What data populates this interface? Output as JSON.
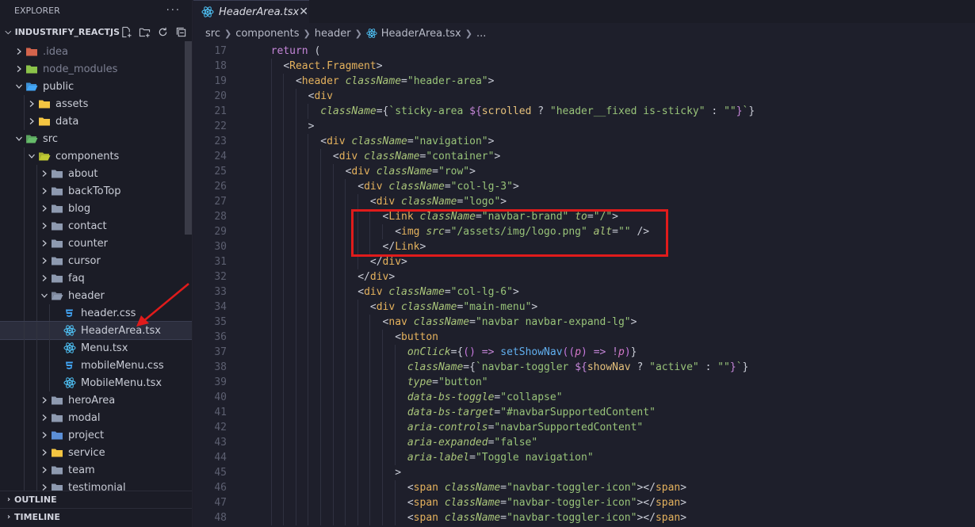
{
  "sidebar": {
    "title": "EXPLORER",
    "more": "···",
    "workspace": "INDUSTRIFY_REACTJS",
    "actions": [
      "new-file-icon",
      "new-folder-icon",
      "refresh-icon",
      "collapse-all-icon"
    ],
    "tree": [
      {
        "label": ".idea",
        "depth": 0,
        "type": "folder",
        "icon": "idea-folder-icon",
        "color": "#d4644c",
        "dim": true
      },
      {
        "label": "node_modules",
        "depth": 0,
        "type": "folder",
        "icon": "node-folder-icon",
        "color": "#8bc34a",
        "dim": true
      },
      {
        "label": "public",
        "depth": 0,
        "type": "folder-open",
        "icon": "public-folder-icon",
        "color": "#42a5f5"
      },
      {
        "label": "assets",
        "depth": 1,
        "type": "folder",
        "icon": "folder-icon",
        "color": "#f4c542"
      },
      {
        "label": "data",
        "depth": 1,
        "type": "folder",
        "icon": "folder-icon",
        "color": "#f4c542"
      },
      {
        "label": "src",
        "depth": 0,
        "type": "folder-open",
        "icon": "src-folder-icon",
        "color": "#66bb6a"
      },
      {
        "label": "components",
        "depth": 1,
        "type": "folder-open",
        "icon": "components-folder-icon",
        "color": "#c0ca33"
      },
      {
        "label": "about",
        "depth": 2,
        "type": "folder",
        "icon": "folder-icon",
        "color": "#8e9ab0"
      },
      {
        "label": "backToTop",
        "depth": 2,
        "type": "folder",
        "icon": "folder-icon",
        "color": "#8e9ab0"
      },
      {
        "label": "blog",
        "depth": 2,
        "type": "folder",
        "icon": "folder-icon",
        "color": "#8e9ab0"
      },
      {
        "label": "contact",
        "depth": 2,
        "type": "folder",
        "icon": "folder-icon",
        "color": "#8e9ab0"
      },
      {
        "label": "counter",
        "depth": 2,
        "type": "folder",
        "icon": "folder-icon",
        "color": "#8e9ab0"
      },
      {
        "label": "cursor",
        "depth": 2,
        "type": "folder",
        "icon": "folder-icon",
        "color": "#8e9ab0"
      },
      {
        "label": "faq",
        "depth": 2,
        "type": "folder",
        "icon": "folder-icon",
        "color": "#8e9ab0"
      },
      {
        "label": "header",
        "depth": 2,
        "type": "folder-open",
        "icon": "folder-icon",
        "color": "#8e9ab0"
      },
      {
        "label": "header.css",
        "depth": 3,
        "type": "css",
        "icon": "css-file-icon",
        "color": "#42a5f5"
      },
      {
        "label": "HeaderArea.tsx",
        "depth": 3,
        "type": "react",
        "icon": "react-file-icon",
        "color": "#4fc3f7",
        "selected": true
      },
      {
        "label": "Menu.tsx",
        "depth": 3,
        "type": "react",
        "icon": "react-file-icon",
        "color": "#4fc3f7"
      },
      {
        "label": "mobileMenu.css",
        "depth": 3,
        "type": "css",
        "icon": "css-file-icon",
        "color": "#42a5f5"
      },
      {
        "label": "MobileMenu.tsx",
        "depth": 3,
        "type": "react",
        "icon": "react-file-icon",
        "color": "#4fc3f7"
      },
      {
        "label": "heroArea",
        "depth": 2,
        "type": "folder",
        "icon": "folder-icon",
        "color": "#8e9ab0"
      },
      {
        "label": "modal",
        "depth": 2,
        "type": "folder",
        "icon": "folder-icon",
        "color": "#8e9ab0"
      },
      {
        "label": "project",
        "depth": 2,
        "type": "folder",
        "icon": "project-folder-icon",
        "color": "#5c8fd6"
      },
      {
        "label": "service",
        "depth": 2,
        "type": "folder",
        "icon": "service-folder-icon",
        "color": "#f4c542"
      },
      {
        "label": "team",
        "depth": 2,
        "type": "folder",
        "icon": "folder-icon",
        "color": "#8e9ab0"
      },
      {
        "label": "testimonial",
        "depth": 2,
        "type": "folder",
        "icon": "folder-icon",
        "color": "#8e9ab0"
      }
    ],
    "outline": "OUTLINE",
    "timeline": "TIMELINE"
  },
  "editor": {
    "tab": {
      "label": "HeaderArea.tsx",
      "close": "✕"
    },
    "breadcrumbs": [
      "src",
      "components",
      "header",
      "HeaderArea.tsx",
      "..."
    ],
    "lines": [
      {
        "n": "17",
        "indent": 0,
        "tokens": [
          [
            "kw",
            "return"
          ],
          [
            "punc",
            " ("
          ]
        ]
      },
      {
        "n": "18",
        "indent": 1,
        "tokens": [
          [
            "punc",
            "<"
          ],
          [
            "tag",
            "React.Fragment"
          ],
          [
            "punc",
            ">"
          ]
        ]
      },
      {
        "n": "19",
        "indent": 2,
        "tokens": [
          [
            "punc",
            "<"
          ],
          [
            "tag",
            "header"
          ],
          [
            "punc",
            " "
          ],
          [
            "attr",
            "className"
          ],
          [
            "punc",
            "="
          ],
          [
            "str",
            "\"header-area\""
          ],
          [
            "punc",
            ">"
          ]
        ]
      },
      {
        "n": "20",
        "indent": 3,
        "tokens": [
          [
            "punc",
            "<"
          ],
          [
            "tag",
            "div"
          ]
        ]
      },
      {
        "n": "21",
        "indent": 4,
        "tokens": [
          [
            "attr",
            "className"
          ],
          [
            "punc",
            "={"
          ],
          [
            "str",
            "`sticky-area "
          ],
          [
            "kw",
            "${"
          ],
          [
            "var",
            "scrolled"
          ],
          [
            "punc",
            " ? "
          ],
          [
            "str",
            "\"header__fixed is-sticky\""
          ],
          [
            "punc",
            " : "
          ],
          [
            "str",
            "\"\""
          ],
          [
            "kw",
            "}"
          ],
          [
            "str",
            "`"
          ],
          [
            "punc",
            "}"
          ]
        ]
      },
      {
        "n": "22",
        "indent": 3,
        "tokens": [
          [
            "punc",
            ">"
          ]
        ]
      },
      {
        "n": "23",
        "indent": 4,
        "tokens": [
          [
            "punc",
            "<"
          ],
          [
            "tag",
            "div"
          ],
          [
            "punc",
            " "
          ],
          [
            "attr",
            "className"
          ],
          [
            "punc",
            "="
          ],
          [
            "str",
            "\"navigation\""
          ],
          [
            "punc",
            ">"
          ]
        ]
      },
      {
        "n": "24",
        "indent": 5,
        "tokens": [
          [
            "punc",
            "<"
          ],
          [
            "tag",
            "div"
          ],
          [
            "punc",
            " "
          ],
          [
            "attr",
            "className"
          ],
          [
            "punc",
            "="
          ],
          [
            "str",
            "\"container\""
          ],
          [
            "punc",
            ">"
          ]
        ]
      },
      {
        "n": "25",
        "indent": 6,
        "tokens": [
          [
            "punc",
            "<"
          ],
          [
            "tag",
            "div"
          ],
          [
            "punc",
            " "
          ],
          [
            "attr",
            "className"
          ],
          [
            "punc",
            "="
          ],
          [
            "str",
            "\"row\""
          ],
          [
            "punc",
            ">"
          ]
        ]
      },
      {
        "n": "26",
        "indent": 7,
        "tokens": [
          [
            "punc",
            "<"
          ],
          [
            "tag",
            "div"
          ],
          [
            "punc",
            " "
          ],
          [
            "attr",
            "className"
          ],
          [
            "punc",
            "="
          ],
          [
            "str",
            "\"col-lg-3\""
          ],
          [
            "punc",
            ">"
          ]
        ]
      },
      {
        "n": "27",
        "indent": 8,
        "tokens": [
          [
            "punc",
            "<"
          ],
          [
            "tag",
            "div"
          ],
          [
            "punc",
            " "
          ],
          [
            "attr",
            "className"
          ],
          [
            "punc",
            "="
          ],
          [
            "str",
            "\"logo\""
          ],
          [
            "punc",
            ">"
          ]
        ]
      },
      {
        "n": "28",
        "indent": 9,
        "tokens": [
          [
            "punc",
            "<"
          ],
          [
            "tag",
            "Link"
          ],
          [
            "punc",
            " "
          ],
          [
            "attr",
            "className"
          ],
          [
            "punc",
            "="
          ],
          [
            "str",
            "\"navbar-brand\""
          ],
          [
            "punc",
            " "
          ],
          [
            "attr",
            "to"
          ],
          [
            "punc",
            "="
          ],
          [
            "str",
            "\"/\""
          ],
          [
            "punc",
            ">"
          ]
        ]
      },
      {
        "n": "29",
        "indent": 10,
        "tokens": [
          [
            "punc",
            "<"
          ],
          [
            "tag",
            "img"
          ],
          [
            "punc",
            " "
          ],
          [
            "attr",
            "src"
          ],
          [
            "punc",
            "="
          ],
          [
            "str",
            "\"/assets/img/logo.png\""
          ],
          [
            "punc",
            " "
          ],
          [
            "attr",
            "alt"
          ],
          [
            "punc",
            "="
          ],
          [
            "str",
            "\"\""
          ],
          [
            "punc",
            " />"
          ]
        ]
      },
      {
        "n": "30",
        "indent": 9,
        "tokens": [
          [
            "punc",
            "</"
          ],
          [
            "tag",
            "Link"
          ],
          [
            "punc",
            ">"
          ]
        ]
      },
      {
        "n": "31",
        "indent": 8,
        "tokens": [
          [
            "punc",
            "</"
          ],
          [
            "tag",
            "div"
          ],
          [
            "punc",
            ">"
          ]
        ]
      },
      {
        "n": "32",
        "indent": 7,
        "tokens": [
          [
            "punc",
            "</"
          ],
          [
            "tag",
            "div"
          ],
          [
            "punc",
            ">"
          ]
        ]
      },
      {
        "n": "33",
        "indent": 7,
        "tokens": [
          [
            "punc",
            "<"
          ],
          [
            "tag",
            "div"
          ],
          [
            "punc",
            " "
          ],
          [
            "attr",
            "className"
          ],
          [
            "punc",
            "="
          ],
          [
            "str",
            "\"col-lg-6\""
          ],
          [
            "punc",
            ">"
          ]
        ]
      },
      {
        "n": "34",
        "indent": 8,
        "tokens": [
          [
            "punc",
            "<"
          ],
          [
            "tag",
            "div"
          ],
          [
            "punc",
            " "
          ],
          [
            "attr",
            "className"
          ],
          [
            "punc",
            "="
          ],
          [
            "str",
            "\"main-menu\""
          ],
          [
            "punc",
            ">"
          ]
        ]
      },
      {
        "n": "35",
        "indent": 9,
        "tokens": [
          [
            "punc",
            "<"
          ],
          [
            "tag",
            "nav"
          ],
          [
            "punc",
            " "
          ],
          [
            "attr",
            "className"
          ],
          [
            "punc",
            "="
          ],
          [
            "str",
            "\"navbar navbar-expand-lg\""
          ],
          [
            "punc",
            ">"
          ]
        ]
      },
      {
        "n": "36",
        "indent": 10,
        "tokens": [
          [
            "punc",
            "<"
          ],
          [
            "tag",
            "button"
          ]
        ]
      },
      {
        "n": "37",
        "indent": 11,
        "tokens": [
          [
            "attr",
            "onClick"
          ],
          [
            "punc",
            "={"
          ],
          [
            "bracket",
            "("
          ],
          [
            "bracket",
            ")"
          ],
          [
            "punc",
            " "
          ],
          [
            "kw",
            "=>"
          ],
          [
            "punc",
            " "
          ],
          [
            "fn",
            "setShowNav"
          ],
          [
            "bracket",
            "(("
          ],
          [
            "param",
            "p"
          ],
          [
            "bracket",
            ")"
          ],
          [
            "punc",
            " "
          ],
          [
            "kw",
            "=>"
          ],
          [
            "punc",
            " "
          ],
          [
            "kw",
            "!"
          ],
          [
            "param",
            "p"
          ],
          [
            "bracket",
            ")"
          ],
          [
            "punc",
            "}"
          ]
        ]
      },
      {
        "n": "38",
        "indent": 11,
        "tokens": [
          [
            "attr",
            "className"
          ],
          [
            "punc",
            "={"
          ],
          [
            "str",
            "`navbar-toggler "
          ],
          [
            "kw",
            "${"
          ],
          [
            "var",
            "showNav"
          ],
          [
            "punc",
            " ? "
          ],
          [
            "str",
            "\"active\""
          ],
          [
            "punc",
            " : "
          ],
          [
            "str",
            "\"\""
          ],
          [
            "kw",
            "}"
          ],
          [
            "str",
            "`"
          ],
          [
            "punc",
            "}"
          ]
        ]
      },
      {
        "n": "39",
        "indent": 11,
        "tokens": [
          [
            "attr",
            "type"
          ],
          [
            "punc",
            "="
          ],
          [
            "str",
            "\"button\""
          ]
        ]
      },
      {
        "n": "40",
        "indent": 11,
        "tokens": [
          [
            "attr",
            "data-bs-toggle"
          ],
          [
            "punc",
            "="
          ],
          [
            "str",
            "\"collapse\""
          ]
        ]
      },
      {
        "n": "41",
        "indent": 11,
        "tokens": [
          [
            "attr",
            "data-bs-target"
          ],
          [
            "punc",
            "="
          ],
          [
            "str",
            "\"#navbarSupportedContent\""
          ]
        ]
      },
      {
        "n": "42",
        "indent": 11,
        "tokens": [
          [
            "attr",
            "aria-controls"
          ],
          [
            "punc",
            "="
          ],
          [
            "str",
            "\"navbarSupportedContent\""
          ]
        ]
      },
      {
        "n": "43",
        "indent": 11,
        "tokens": [
          [
            "attr",
            "aria-expanded"
          ],
          [
            "punc",
            "="
          ],
          [
            "str",
            "\"false\""
          ]
        ]
      },
      {
        "n": "44",
        "indent": 11,
        "tokens": [
          [
            "attr",
            "aria-label"
          ],
          [
            "punc",
            "="
          ],
          [
            "str",
            "\"Toggle navigation\""
          ]
        ]
      },
      {
        "n": "45",
        "indent": 10,
        "tokens": [
          [
            "punc",
            ">"
          ]
        ]
      },
      {
        "n": "46",
        "indent": 11,
        "tokens": [
          [
            "punc",
            "<"
          ],
          [
            "tag",
            "span"
          ],
          [
            "punc",
            " "
          ],
          [
            "attr",
            "className"
          ],
          [
            "punc",
            "="
          ],
          [
            "str",
            "\"navbar-toggler-icon\""
          ],
          [
            "punc",
            "></"
          ],
          [
            "tag",
            "span"
          ],
          [
            "punc",
            ">"
          ]
        ]
      },
      {
        "n": "47",
        "indent": 11,
        "tokens": [
          [
            "punc",
            "<"
          ],
          [
            "tag",
            "span"
          ],
          [
            "punc",
            " "
          ],
          [
            "attr",
            "className"
          ],
          [
            "punc",
            "="
          ],
          [
            "str",
            "\"navbar-toggler-icon\""
          ],
          [
            "punc",
            "></"
          ],
          [
            "tag",
            "span"
          ],
          [
            "punc",
            ">"
          ]
        ]
      },
      {
        "n": "48",
        "indent": 11,
        "tokens": [
          [
            "punc",
            "<"
          ],
          [
            "tag",
            "span"
          ],
          [
            "punc",
            " "
          ],
          [
            "attr",
            "className"
          ],
          [
            "punc",
            "="
          ],
          [
            "str",
            "\"navbar-toggler-icon\""
          ],
          [
            "punc",
            "></"
          ],
          [
            "tag",
            "span"
          ],
          [
            "punc",
            ">"
          ]
        ]
      }
    ]
  },
  "annotation": {
    "box_color": "#e01b1b",
    "arrow_color": "#e01b1b"
  }
}
